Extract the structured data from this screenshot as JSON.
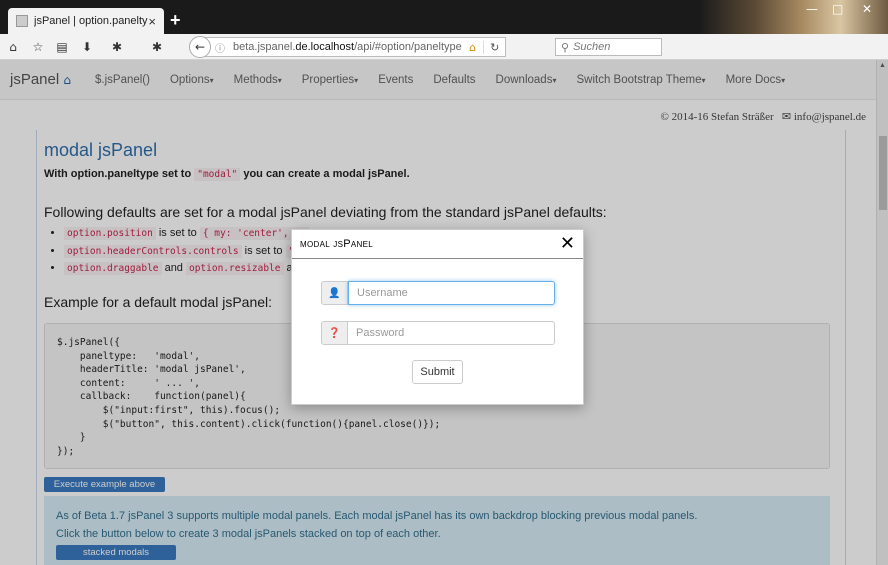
{
  "browser": {
    "tab_title": "jsPanel | option.paneltype",
    "tab_close": "×",
    "new_tab": "+",
    "window_controls": [
      "—",
      "□",
      "✕"
    ],
    "url_prefix": "beta.jspanel.",
    "url_domain": "de.localhost",
    "url_path": "/api/#option/paneltype",
    "search_placeholder": "Suchen",
    "nav_icons": {
      "home": "⌂",
      "bookmark": "☆",
      "reading-list": "▤",
      "download": "⬇",
      "addon": "✱",
      "back": "←",
      "info": "ⓘ",
      "home-url": "⌂",
      "reload": "↻",
      "search": "⚲"
    }
  },
  "site": {
    "brand": "jsPanel",
    "brand_icon": "⌂",
    "nav": [
      {
        "label": "$.jsPanel()",
        "caret": ""
      },
      {
        "label": "Options",
        "caret": "▾"
      },
      {
        "label": "Methods",
        "caret": "▾"
      },
      {
        "label": "Properties",
        "caret": "▾"
      },
      {
        "label": "Events",
        "caret": ""
      },
      {
        "label": "Defaults",
        "caret": ""
      },
      {
        "label": "Downloads",
        "caret": "▾"
      },
      {
        "label": "Switch Bootstrap Theme",
        "caret": "▾"
      },
      {
        "label": "More Docs",
        "caret": "▾"
      }
    ],
    "copyright": "© 2014-16 Stefan Sträßer",
    "email": "✉ info@jspanel.de"
  },
  "doc": {
    "heading": "modal jsPanel",
    "intro_pre": "With option.paneltype set to ",
    "intro_code": "\"modal\"",
    "intro_post": " you can create a modal jsPanel.",
    "defaults_heading": "Following defaults are set for a modal jsPanel deviating from the standard jsPanel defaults:",
    "bullets": [
      {
        "code": "option.position",
        "text": " is set to ",
        "code2": "{ my: 'center', at"
      },
      {
        "code": "option.headerControls.controls",
        "text": " is set to ",
        "code2": "\"cl"
      },
      {
        "code": "option.draggable",
        "text": " and ",
        "code2": "option.resizable",
        "text2": " are"
      }
    ],
    "example_heading": "Example for a default modal jsPanel:",
    "code_lines": [
      "$.jsPanel({",
      "    paneltype:   'modal',",
      "    headerTitle: 'modal jsPanel',",
      "    content:     ' ... ',",
      "    callback:    function(panel){",
      "        $(\"input:first\", this).focus();",
      "        $(\"button\", this.content).click(function(){panel.close()});",
      "    }",
      "});"
    ],
    "execute_button": "Execute example above",
    "info_line1": "As of Beta 1.7 jsPanel 3 supports multiple modal panels. Each modal jsPanel has its own backdrop blocking previous modal panels.",
    "info_line2": "Click the button below to create 3 modal jsPanels stacked on top of each other.",
    "stacked_button": "stacked modals"
  },
  "modal": {
    "title": "modal jsPanel",
    "close": "✕",
    "username_icon": "👤",
    "username_placeholder": "Username",
    "username_value": "",
    "password_icon": "❓",
    "password_placeholder": "Password",
    "password_value": "",
    "submit_label": "Submit"
  }
}
